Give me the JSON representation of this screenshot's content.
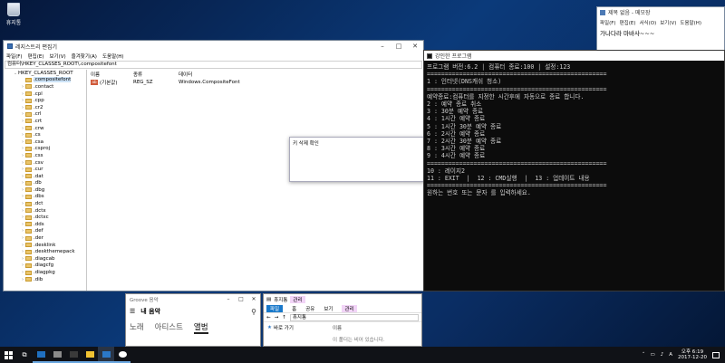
{
  "desktop": {
    "recycle_bin": "휴지통"
  },
  "notepad": {
    "title": "제목 없음 - 메모장",
    "menu": [
      "파일(F)",
      "편집(E)",
      "서식(O)",
      "보기(V)",
      "도움말(H)"
    ],
    "content": "가나다라 마바사~~~"
  },
  "regedit": {
    "title": "레지스트리 편집기",
    "menu": [
      "파일(F)",
      "편집(E)",
      "보기(V)",
      "즐겨찾기(A)",
      "도움말(H)"
    ],
    "address": "컴퓨터\\HKEY_CLASSES_ROOT\\.compositefont",
    "root": "HKEY_CLASSES_ROOT",
    "selected_key": ".compositefont",
    "keys": [
      ".contact",
      ".cpl",
      ".cpp",
      ".cr2",
      ".crl",
      ".crt",
      ".crw",
      ".cs",
      ".csa",
      ".csproj",
      ".css",
      ".csv",
      ".cur",
      ".dat",
      ".db",
      ".dbg",
      ".dbs",
      ".dct",
      ".dctx",
      ".dctxc",
      ".dds",
      ".def",
      ".der",
      ".desklink",
      ".deskthemepack",
      ".diagcab",
      ".diagcfg",
      ".diagpkg",
      ".dib"
    ],
    "columns": {
      "name": "이름",
      "type": "종류",
      "data": "데이터"
    },
    "values": [
      {
        "name": "(기본값)",
        "type": "REG_SZ",
        "data": "Windows.CompositeFont"
      }
    ]
  },
  "popup": {
    "text": "키 삭제 확인"
  },
  "console": {
    "title": "강인한 프로그램",
    "lines": [
      "프로그램 버전:6.2 | 컴퓨터 종료:100 | 설정:123",
      "==================================================",
      "1 : 인터넷(DNS캐쉬 청소)",
      "==================================================",
      "예약종료:컴퓨터를 지정한 시간후에 자동으로 종료 합니다.",
      "2 : 예약 종료 취소",
      "3 : 30분 예약 종료",
      "4 : 1시간 예약 종료",
      "5 : 1시간 30분 예약 종료",
      "6 : 2시간 예약 종료",
      "7 : 2시간 30분 예약 종료",
      "8 : 3시간 예약 종료",
      "9 : 4시간 예약 종료",
      "==================================================",
      "10 : 레이지2",
      "11 : EXIT  |  12 : CMD실행  |  13 : 업데이트 내용",
      "==================================================",
      "원하는 번호 또는 문자 를 입력하세요."
    ]
  },
  "groove": {
    "title": "Groove 음악",
    "heading": "내 음악",
    "tabs": [
      "노래",
      "아티스트",
      "앨범"
    ],
    "active_tab": "앨범"
  },
  "explorer": {
    "title": "휴지통",
    "manage": "관리",
    "ribbon": [
      "파일",
      "홈",
      "공유",
      "보기"
    ],
    "address": "휴지통",
    "quick_access": "바로 가기",
    "column": "이름",
    "empty": "이 폴더는 비어 있습니다."
  },
  "taskbar": {
    "time": "오후 6:19",
    "date": "2017-12-20",
    "app_colors": [
      "#1f6fbf",
      "#8a8a8a",
      "#3a3a3a",
      "#f1c232",
      "#2b78c8",
      "#ffffff"
    ]
  }
}
